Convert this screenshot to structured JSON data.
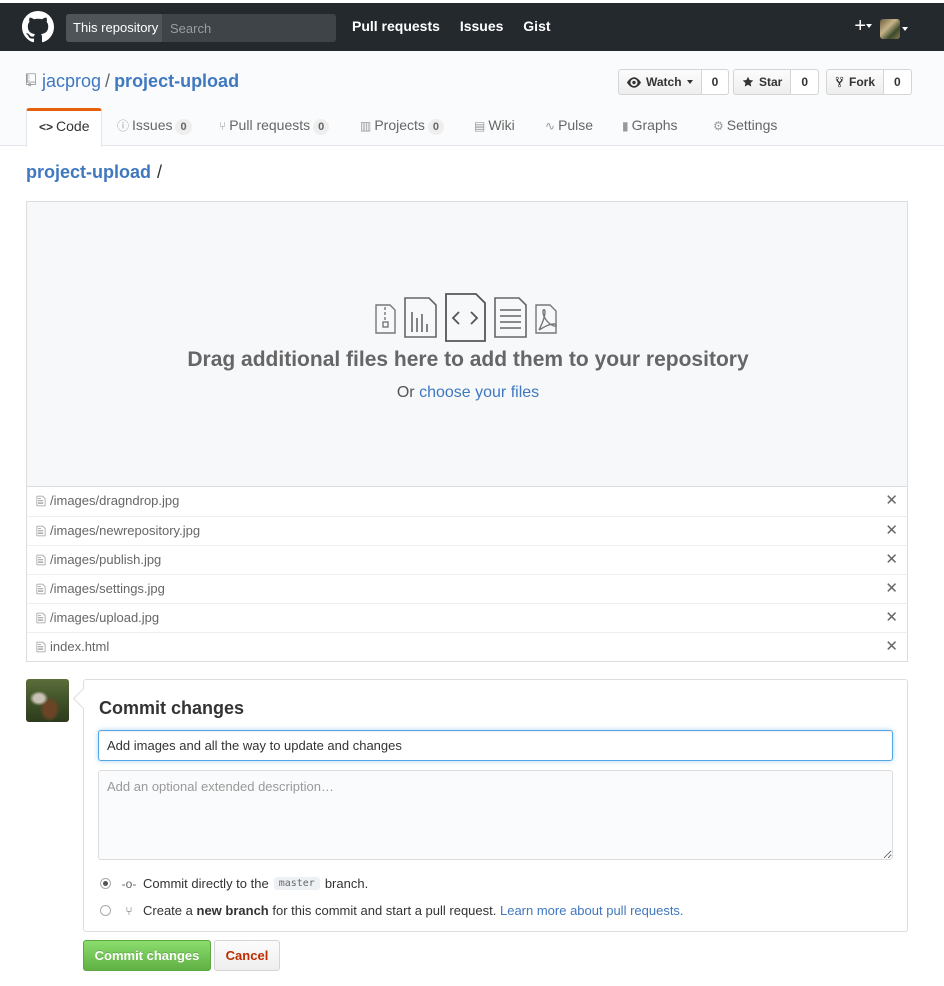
{
  "header": {
    "search_scope": "This repository",
    "search_placeholder": "Search",
    "nav": [
      "Pull requests",
      "Issues",
      "Gist"
    ],
    "plus_glyph": "+"
  },
  "repo": {
    "owner": "jacprog",
    "separator": "/",
    "name": "project-upload",
    "watch_label": "Watch",
    "watch_count": "0",
    "star_label": "Star",
    "star_count": "0",
    "fork_label": "Fork",
    "fork_count": "0",
    "tabs": [
      {
        "label": "Code",
        "icon": "code-icon",
        "selected": true
      },
      {
        "label": "Issues",
        "count": "0",
        "icon": "issue-icon"
      },
      {
        "label": "Pull requests",
        "count": "0",
        "icon": "pull-request-icon"
      },
      {
        "label": "Projects",
        "count": "0",
        "icon": "project-icon"
      },
      {
        "label": "Wiki",
        "icon": "book-icon"
      },
      {
        "label": "Pulse",
        "icon": "pulse-icon"
      },
      {
        "label": "Graphs",
        "icon": "graph-icon"
      },
      {
        "label": "Settings",
        "icon": "gear-icon"
      }
    ]
  },
  "breadcrumb": {
    "repo": "project-upload",
    "slash": "/"
  },
  "dropzone": {
    "title": "Drag additional files here to add them to your repository",
    "or_text": "Or",
    "choose_link": "choose your files"
  },
  "files": [
    "/images/dragndrop.jpg",
    "/images/newrepository.jpg",
    "/images/publish.jpg",
    "/images/settings.jpg",
    "/images/upload.jpg",
    "index.html"
  ],
  "remove_glyph": "✕",
  "commit": {
    "title": "Commit changes",
    "summary_value": "Add images and all the way to update and changes",
    "description_placeholder": "Add an optional extended description…",
    "option1_before": "Commit directly to the",
    "option1_branch": "master",
    "option1_after": "branch.",
    "option2_before": "Create a",
    "option2_bold": "new branch",
    "option2_after": "for this commit and start a pull request.",
    "option2_link": "Learn more about pull requests.",
    "submit_label": "Commit changes",
    "cancel_label": "Cancel"
  },
  "colors": {
    "header_bg": "#24292e",
    "link": "#4078c0",
    "tab_accent": "#e36209",
    "primary_btn": "#60b044",
    "cancel_text": "#bd2c00"
  }
}
